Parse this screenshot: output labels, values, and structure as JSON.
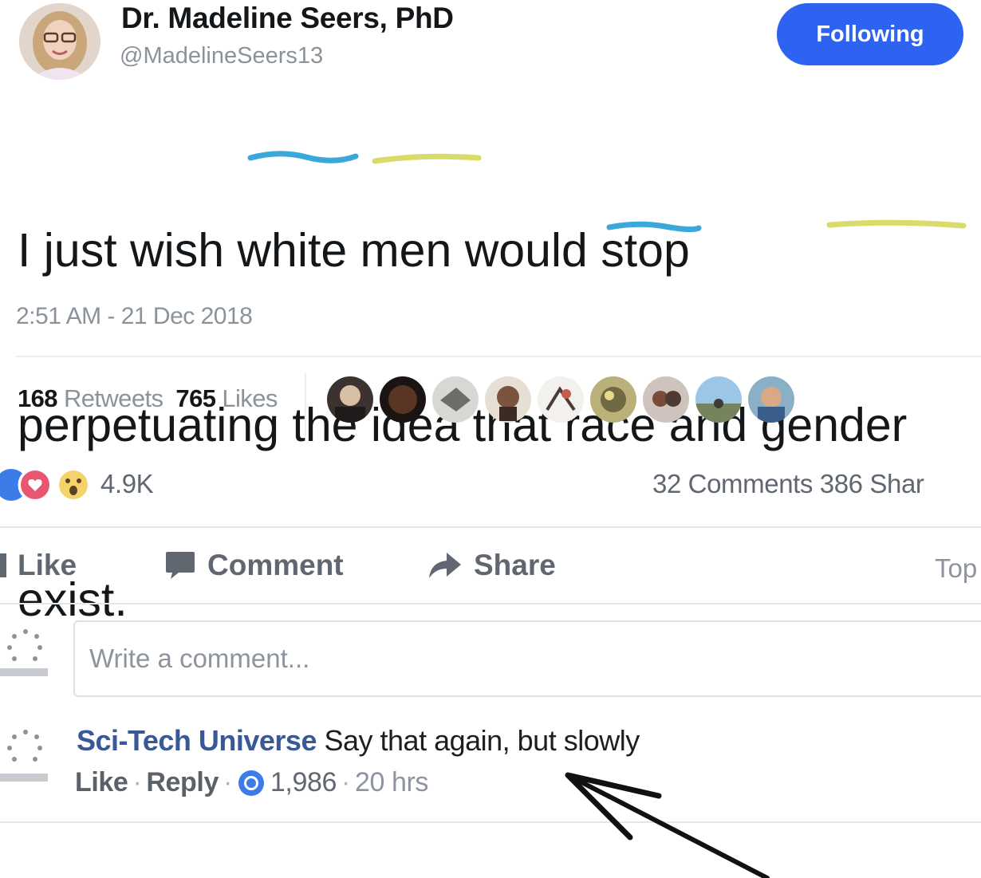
{
  "tweet": {
    "author_name": "Dr. Madeline Seers, PhD",
    "handle": "@MadelineSeers13",
    "follow_label": "Following",
    "text_lines": [
      "I just wish white men would stop",
      "perpetuating the idea that race and gender",
      "exist."
    ],
    "timestamp": "2:51 AM - 21 Dec 2018",
    "retweets_count": "168",
    "retweets_label": "Retweets",
    "likes_count": "765",
    "likes_label": "Likes"
  },
  "facebook": {
    "reaction_count": "4.9K",
    "comments_shares": "32 Comments  386 Shar",
    "actions": {
      "like": "Like",
      "comment": "Comment",
      "share": "Share",
      "top": "Top"
    },
    "comment_placeholder": "Write a comment...",
    "comment": {
      "author": "Sci-Tech Universe",
      "text": "Say that again, but slowly",
      "like_label": "Like",
      "reply_label": "Reply",
      "reaction_count": "1,986",
      "time": "20 hrs"
    }
  },
  "colors": {
    "follow_button": "#2e62f0",
    "underline_blue": "#3aa8d8",
    "underline_yellow": "#d9dc6a",
    "fb_link": "#385898"
  },
  "icons": [
    "comment-icon",
    "share-arrow-icon",
    "like-thumb-icon",
    "heart-reaction-icon",
    "wow-reaction-icon"
  ]
}
